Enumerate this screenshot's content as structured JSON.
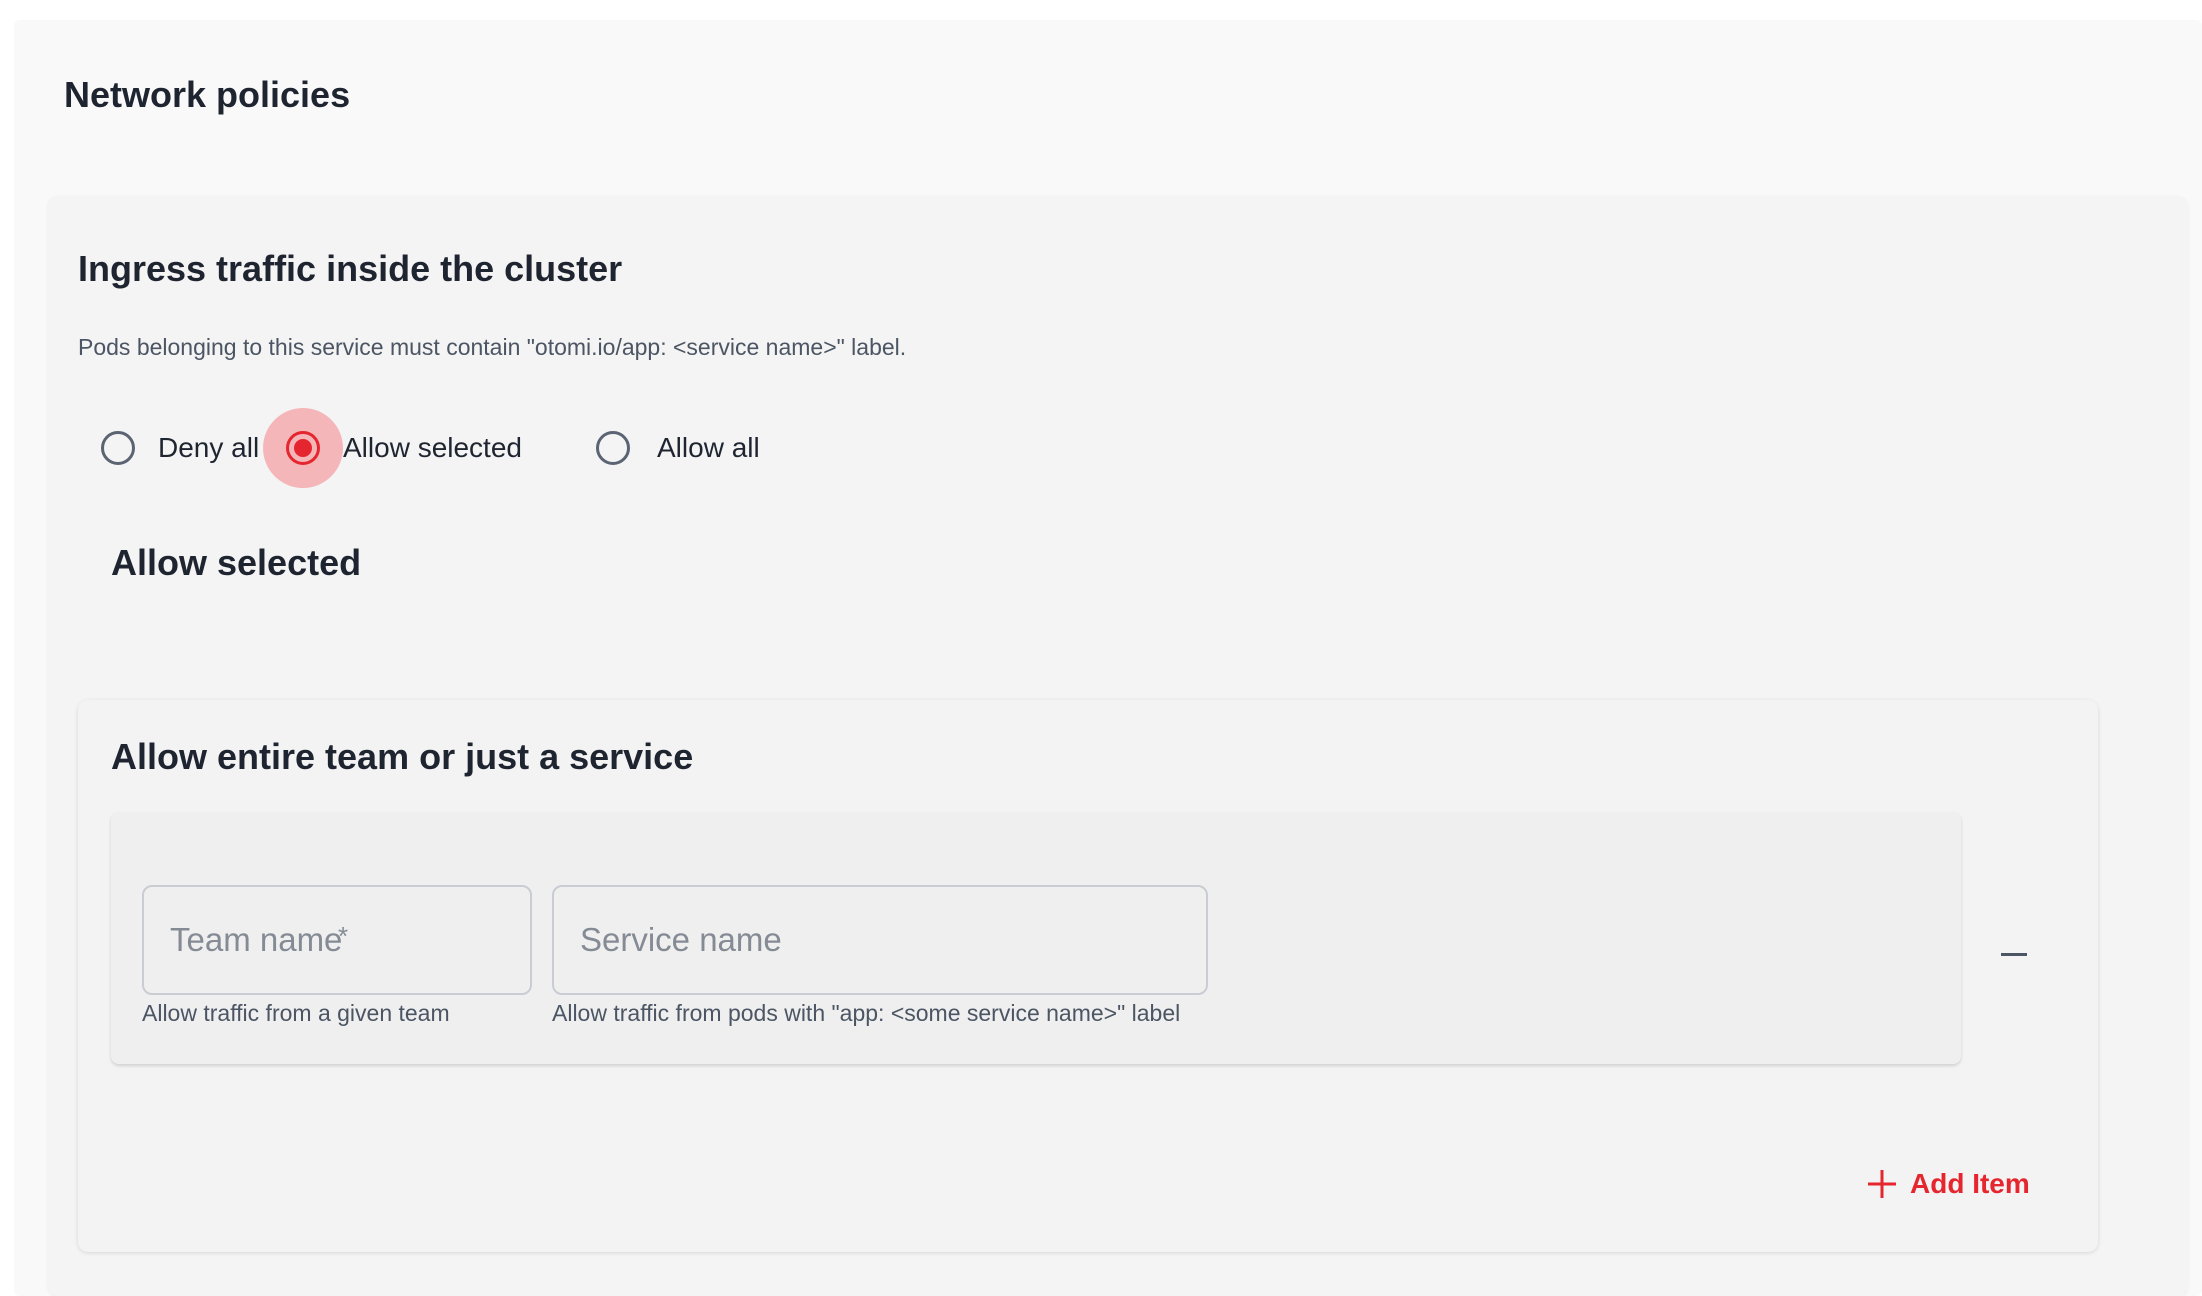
{
  "page": {
    "title": "Network policies"
  },
  "ingress": {
    "title": "Ingress traffic inside the cluster",
    "description": "Pods belonging to this service must contain \"otomi.io/app: <service name>\" label.",
    "options": [
      {
        "label": "Deny all",
        "checked": false
      },
      {
        "label": "Allow selected",
        "checked": true
      },
      {
        "label": "Allow all",
        "checked": false
      }
    ],
    "selected_heading": "Allow selected"
  },
  "allow_list": {
    "title": "Allow entire team or just a service",
    "items": [
      {
        "team_name": {
          "value": "",
          "placeholder": "Team name",
          "required_marker": "*",
          "helper": "Allow traffic from a given team"
        },
        "service_name": {
          "value": "",
          "placeholder": "Service name",
          "helper": "Allow traffic from pods with \"app: <some service name>\" label"
        }
      }
    ],
    "remove_icon": "minus-icon",
    "add_label": "Add Item",
    "add_icon": "plus-icon"
  },
  "colors": {
    "accent": "#e5262e",
    "text": "#1f2530",
    "muted": "#4b5563"
  }
}
